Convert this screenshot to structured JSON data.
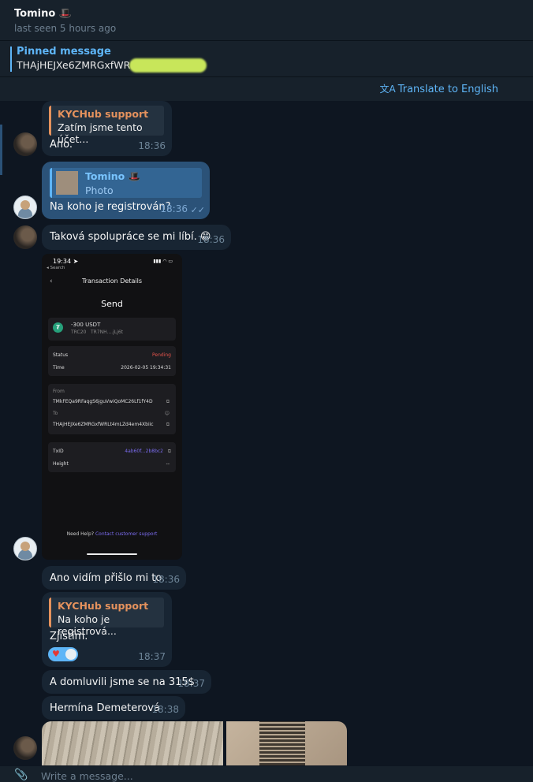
{
  "header": {
    "name": "Tomino",
    "name_emoji": "🎩",
    "status": "last seen 5 hours ago"
  },
  "pinned": {
    "title": "Pinned message",
    "text": "THAjHEJXe6ZMRGxfWRL"
  },
  "translate_label": "Translate to English",
  "messages": {
    "m1": {
      "reply_name": "KYCHub support",
      "reply_text": "Zatím jsme tento účet...",
      "text": "Ano.",
      "time": "18:36"
    },
    "m2": {
      "reply_name": "Tomino 🎩",
      "reply_text": "Photo",
      "text": "Na koho je registrován?",
      "time": "18:36"
    },
    "m3": {
      "text": "Taková spolupráce se mi líbí. 😁",
      "time": "18:36"
    },
    "m4": {
      "text": "Ano vidím přišlo mi to.",
      "time": "18:36"
    },
    "m5": {
      "reply_name": "KYCHub support",
      "reply_text": "Na koho je registrová...",
      "text": "Zjistím.",
      "time": "18:37"
    },
    "m6": {
      "text": "A domluvili jsme se na 315$",
      "time": "18:37"
    },
    "m7": {
      "text": "Hermína Demeterová",
      "time": "18:38"
    }
  },
  "phone": {
    "clock": "19:34 ➤",
    "back_app": "◂ Search",
    "signal": "▮▮▮ ◠ ▭",
    "header": "Transaction Details",
    "action": "Send",
    "amount": "-300 USDT",
    "network": "TRC20",
    "addr_short": "TR7NH....jLj6t",
    "status_label": "Status",
    "status_value": "Pending",
    "time_label": "Time",
    "time_value": "2026-02-05 19:34:31",
    "from_label": "From",
    "from_value": "TMkFEQa9RFaqgS6jguVwiQoMC26Lf1fY4D",
    "to_label": "To",
    "to_value": "THAjHEJXe6ZMRGxfWRLt4mLZd4em4Xbiic",
    "txid_label": "TxID",
    "txid_value": "4ab60f...2b8bc2",
    "height_label": "Height",
    "height_value": "--",
    "help_text": "Need Help?",
    "help_link": "Contact customer support"
  },
  "composer_placeholder": "Write a message..."
}
